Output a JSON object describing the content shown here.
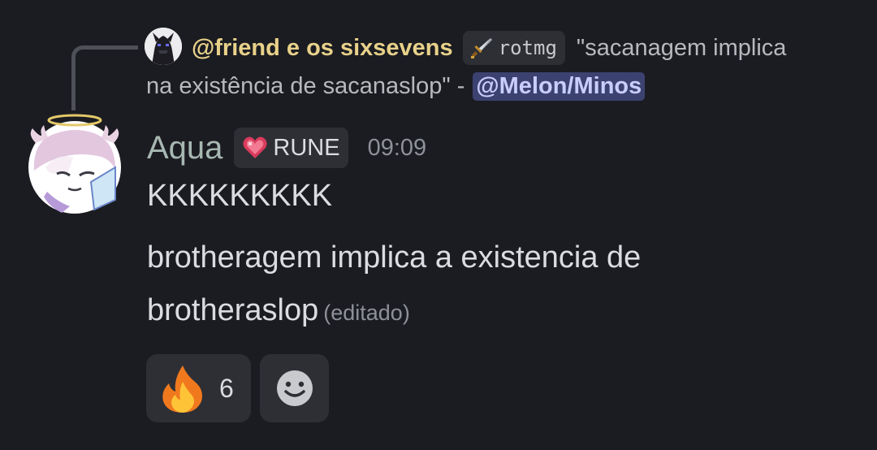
{
  "reply": {
    "author": "@friend e os sixsevens",
    "tag_label": "rotmg",
    "tag_icon": "sword-icon",
    "text_line1": "\"sacanagem implica",
    "text_line2": "na existência de sacanaslop\" -",
    "mention": "@Melon/Minos"
  },
  "message": {
    "author": "Aqua",
    "role_label": "RUNE",
    "role_icon": "heart-icon",
    "timestamp": "09:09",
    "lines": [
      "KKKKKKKKK",
      "brotheragem implica a existencia de",
      "brotheraslop"
    ],
    "edited_label": "(editado)"
  },
  "reactions": [
    {
      "emoji": "fire-icon",
      "count": "6"
    }
  ],
  "add_reaction_icon": "add-reaction-icon",
  "colors": {
    "background": "#1b1c21",
    "reply_author": "#e8d18a",
    "author": "#a7b7b1",
    "mention_bg": "#3c4270",
    "mention_text": "#c9cdfb",
    "chip_bg": "#2d2f35"
  }
}
